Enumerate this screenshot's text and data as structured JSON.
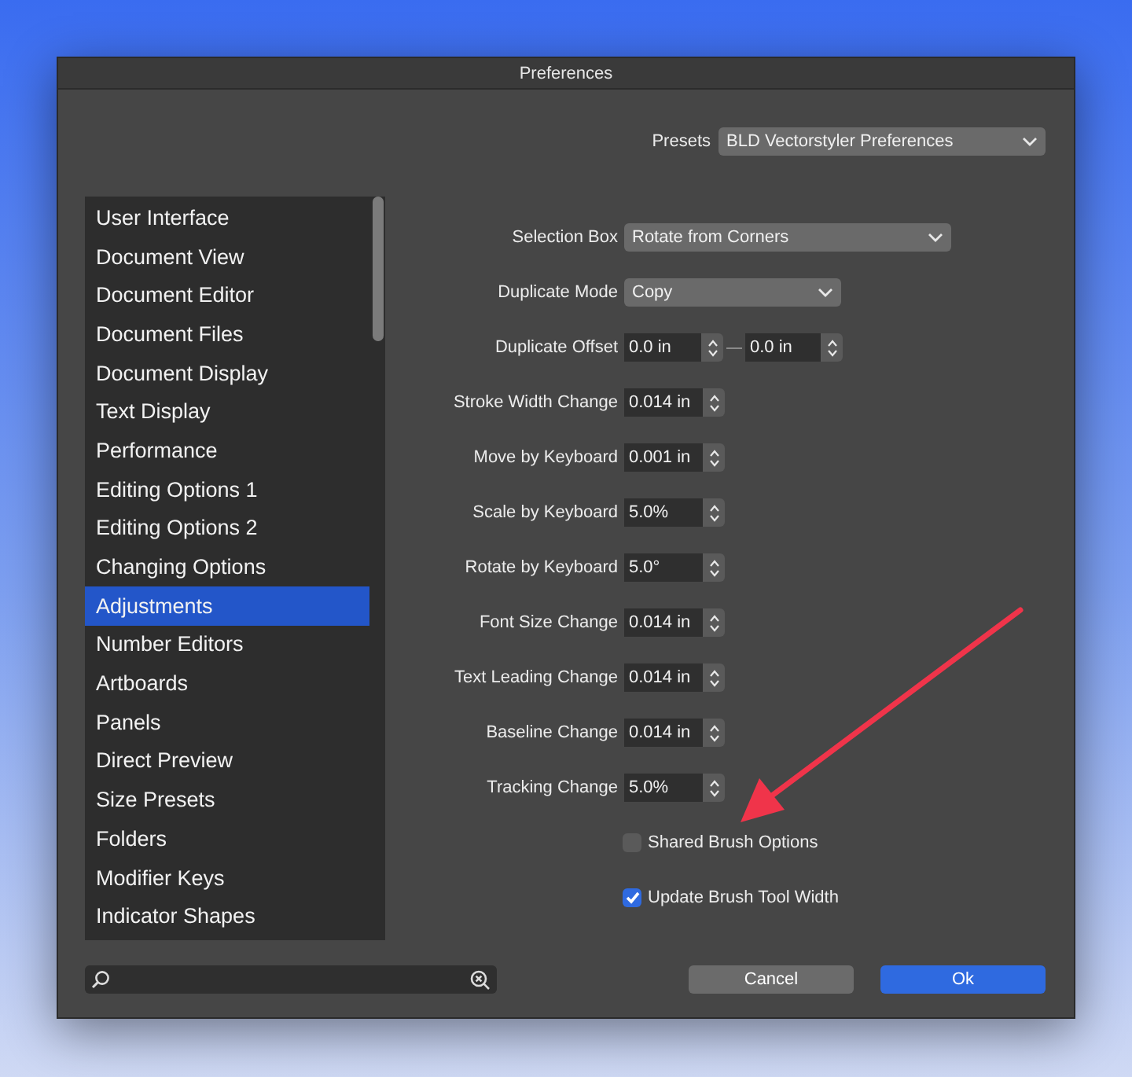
{
  "window": {
    "title": "Preferences"
  },
  "presets": {
    "label": "Presets",
    "value": "BLD Vectorstyler Preferences"
  },
  "sidebar": {
    "items": [
      {
        "label": "User Interface",
        "selected": false
      },
      {
        "label": "Document View",
        "selected": false
      },
      {
        "label": "Document Editor",
        "selected": false
      },
      {
        "label": "Document Files",
        "selected": false
      },
      {
        "label": "Document Display",
        "selected": false
      },
      {
        "label": "Text Display",
        "selected": false
      },
      {
        "label": "Performance",
        "selected": false
      },
      {
        "label": "Editing Options 1",
        "selected": false
      },
      {
        "label": "Editing Options 2",
        "selected": false
      },
      {
        "label": "Changing Options",
        "selected": false
      },
      {
        "label": "Adjustments",
        "selected": true
      },
      {
        "label": "Number Editors",
        "selected": false
      },
      {
        "label": "Artboards",
        "selected": false
      },
      {
        "label": "Panels",
        "selected": false
      },
      {
        "label": "Direct Preview",
        "selected": false
      },
      {
        "label": "Size Presets",
        "selected": false
      },
      {
        "label": "Folders",
        "selected": false
      },
      {
        "label": "Modifier Keys",
        "selected": false
      },
      {
        "label": "Indicator Shapes",
        "selected": false
      }
    ]
  },
  "settings": [
    {
      "kind": "dropdown",
      "label": "Selection Box",
      "value": "Rotate from Corners",
      "wide": true
    },
    {
      "kind": "dropdown",
      "label": "Duplicate Mode",
      "value": "Copy",
      "wide": false
    },
    {
      "kind": "pair",
      "label": "Duplicate Offset",
      "values": [
        "0.0 in",
        "0.0 in"
      ]
    },
    {
      "kind": "stepper",
      "label": "Stroke Width Change",
      "value": "0.014 in"
    },
    {
      "kind": "stepper",
      "label": "Move by Keyboard",
      "value": "0.001 in"
    },
    {
      "kind": "stepper",
      "label": "Scale by Keyboard",
      "value": "5.0%"
    },
    {
      "kind": "stepper",
      "label": "Rotate by Keyboard",
      "value": "5.0°"
    },
    {
      "kind": "stepper",
      "label": "Font Size Change",
      "value": "0.014 in"
    },
    {
      "kind": "stepper",
      "label": "Text Leading Change",
      "value": "0.014 in"
    },
    {
      "kind": "stepper",
      "label": "Baseline Change",
      "value": "0.014 in"
    },
    {
      "kind": "stepper",
      "label": "Tracking Change",
      "value": "5.0%"
    },
    {
      "kind": "checkbox",
      "label": "Shared Brush Options",
      "checked": false
    },
    {
      "kind": "checkbox",
      "label": "Update Brush Tool Width",
      "checked": true
    }
  ],
  "buttons": [
    {
      "label": "Cancel",
      "primary": false
    },
    {
      "label": "Ok",
      "primary": true
    }
  ]
}
